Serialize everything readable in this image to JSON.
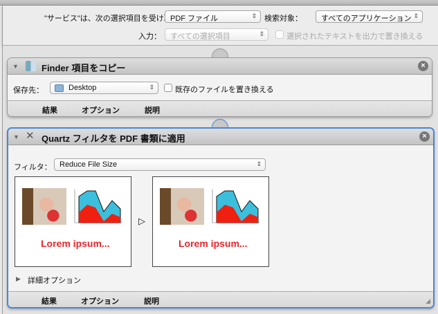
{
  "top": {
    "receives_label": "\"サービス\"は、次の選択項目を受け取る：",
    "receives_value": "PDF ファイル",
    "search_label": "検索対象：",
    "search_value": "すべてのアプリケーション",
    "input_label": "入力：",
    "input_value": "すべての選択項目",
    "replace_label": "選択されたテキストを出力で置き換える"
  },
  "action1": {
    "title": "Finder 項目をコピー",
    "dest_label": "保存先：",
    "dest_value": "Desktop",
    "replace_label": "既存のファイルを置き換える",
    "tabs": [
      "結果",
      "オプション",
      "説明"
    ]
  },
  "action2": {
    "title": "Quartz フィルタを PDF 書類に適用",
    "filter_label": "フィルタ：",
    "filter_value": "Reduce File Size",
    "preview_text": "Lorem ipsum...",
    "advanced_label": "詳細オプション",
    "tabs": [
      "結果",
      "オプション",
      "説明"
    ]
  },
  "colors": {
    "accent": "#4a86d6",
    "lorem": "#e8242a"
  }
}
